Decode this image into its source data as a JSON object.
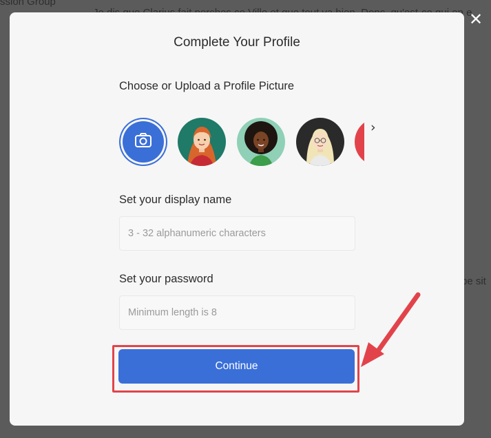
{
  "background": {
    "top_left_text": "ssion Group",
    "top_line_text": "Je dis que Clarius fait porches ce Ville et que tout va bien. Donc, qu'est-ce qui en e",
    "right_text": "pe sit"
  },
  "overlay": {
    "close_glyph": "✕"
  },
  "modal": {
    "title": "Complete Your Profile",
    "picture_section": {
      "label": "Choose or Upload a Profile Picture",
      "next_glyph": "›",
      "avatars": [
        {
          "type": "upload",
          "icon": "camera-icon"
        },
        {
          "type": "preset",
          "description": "red-haired woman",
          "bg": "#1f7a68"
        },
        {
          "type": "preset",
          "description": "curly-haired woman",
          "bg": "#8fd0b7"
        },
        {
          "type": "preset",
          "description": "blonde woman with glasses",
          "bg": "#2a2a2a"
        },
        {
          "type": "preset",
          "description": "partial avatar",
          "bg": "#e2434a"
        }
      ]
    },
    "display_name": {
      "label": "Set your display name",
      "value": "",
      "placeholder": "3 - 32 alphanumeric characters"
    },
    "password": {
      "label": "Set your password",
      "value": "",
      "placeholder": "Minimum length is 8"
    },
    "continue_label": "Continue"
  },
  "colors": {
    "accent": "#3a6fd8",
    "annotation": "#e2434a",
    "backdrop": "#5b5b5b",
    "modal_bg": "#f6f6f6"
  }
}
